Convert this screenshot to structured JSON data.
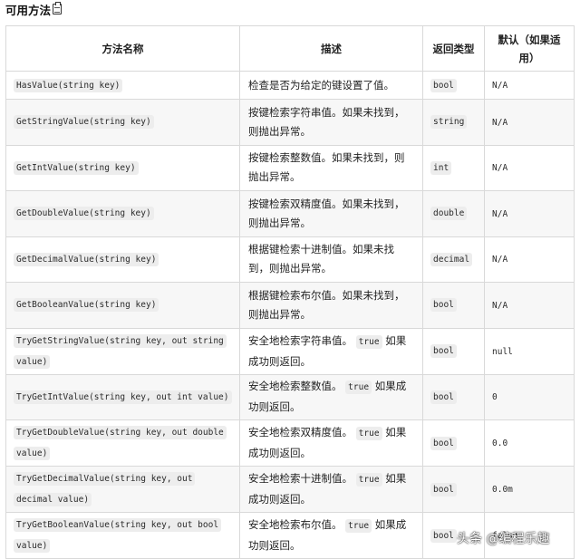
{
  "heading": {
    "title": "可用方法",
    "icon": "clipboard-icon"
  },
  "table": {
    "headers": [
      "方法名称",
      "描述",
      "返回类型",
      "默认（如果适用）"
    ],
    "rows": [
      {
        "method": "HasValue(string key)",
        "desc_before": "检查是否为给定的键设置了值。",
        "desc_code": "",
        "desc_after": "",
        "type": "bool",
        "default": "N/A"
      },
      {
        "method": "GetStringValue(string key)",
        "desc_before": "按键检索字符串值。如果未找到，则抛出异常。",
        "desc_code": "",
        "desc_after": "",
        "type": "string",
        "default": "N/A"
      },
      {
        "method": "GetIntValue(string key)",
        "desc_before": "按键检索整数值。如果未找到，则抛出异常。",
        "desc_code": "",
        "desc_after": "",
        "type": "int",
        "default": "N/A"
      },
      {
        "method": "GetDoubleValue(string key)",
        "desc_before": "按键检索双精度值。如果未找到，则抛出异常。",
        "desc_code": "",
        "desc_after": "",
        "type": "double",
        "default": "N/A"
      },
      {
        "method": "GetDecimalValue(string key)",
        "desc_before": "根据键检索十进制值。如果未找到，则抛出异常。",
        "desc_code": "",
        "desc_after": "",
        "type": "decimal",
        "default": "N/A"
      },
      {
        "method": "GetBooleanValue(string key)",
        "desc_before": "根据键检索布尔值。如果未找到，则抛出异常。",
        "desc_code": "",
        "desc_after": "",
        "type": "bool",
        "default": "N/A"
      },
      {
        "method": "TryGetStringValue(string key, out string value)",
        "desc_before": "安全地检索字符串值。",
        "desc_code": "true",
        "desc_after": "如果成功则返回。",
        "type": "bool",
        "default": "null"
      },
      {
        "method": "TryGetIntValue(string key, out int value)",
        "desc_before": "安全地检索整数值。",
        "desc_code": "true",
        "desc_after": "如果成功则返回。",
        "type": "bool",
        "default": "0"
      },
      {
        "method": "TryGetDoubleValue(string key, out double value)",
        "desc_before": "安全地检索双精度值。",
        "desc_code": "true",
        "desc_after": "如果成功则返回。",
        "type": "bool",
        "default": "0.0"
      },
      {
        "method": "TryGetDecimalValue(string key, out decimal value)",
        "desc_before": "安全地检索十进制值。",
        "desc_code": "true",
        "desc_after": "如果成功则返回。",
        "type": "bool",
        "default": "0.0m"
      },
      {
        "method": "TryGetBooleanValue(string key, out bool value)",
        "desc_before": "安全地检索布尔值。",
        "desc_code": "true",
        "desc_after": "如果成功则返回。",
        "type": "bool",
        "default": "false"
      }
    ]
  },
  "watermark": {
    "text": "头条 @编程乐趣"
  }
}
